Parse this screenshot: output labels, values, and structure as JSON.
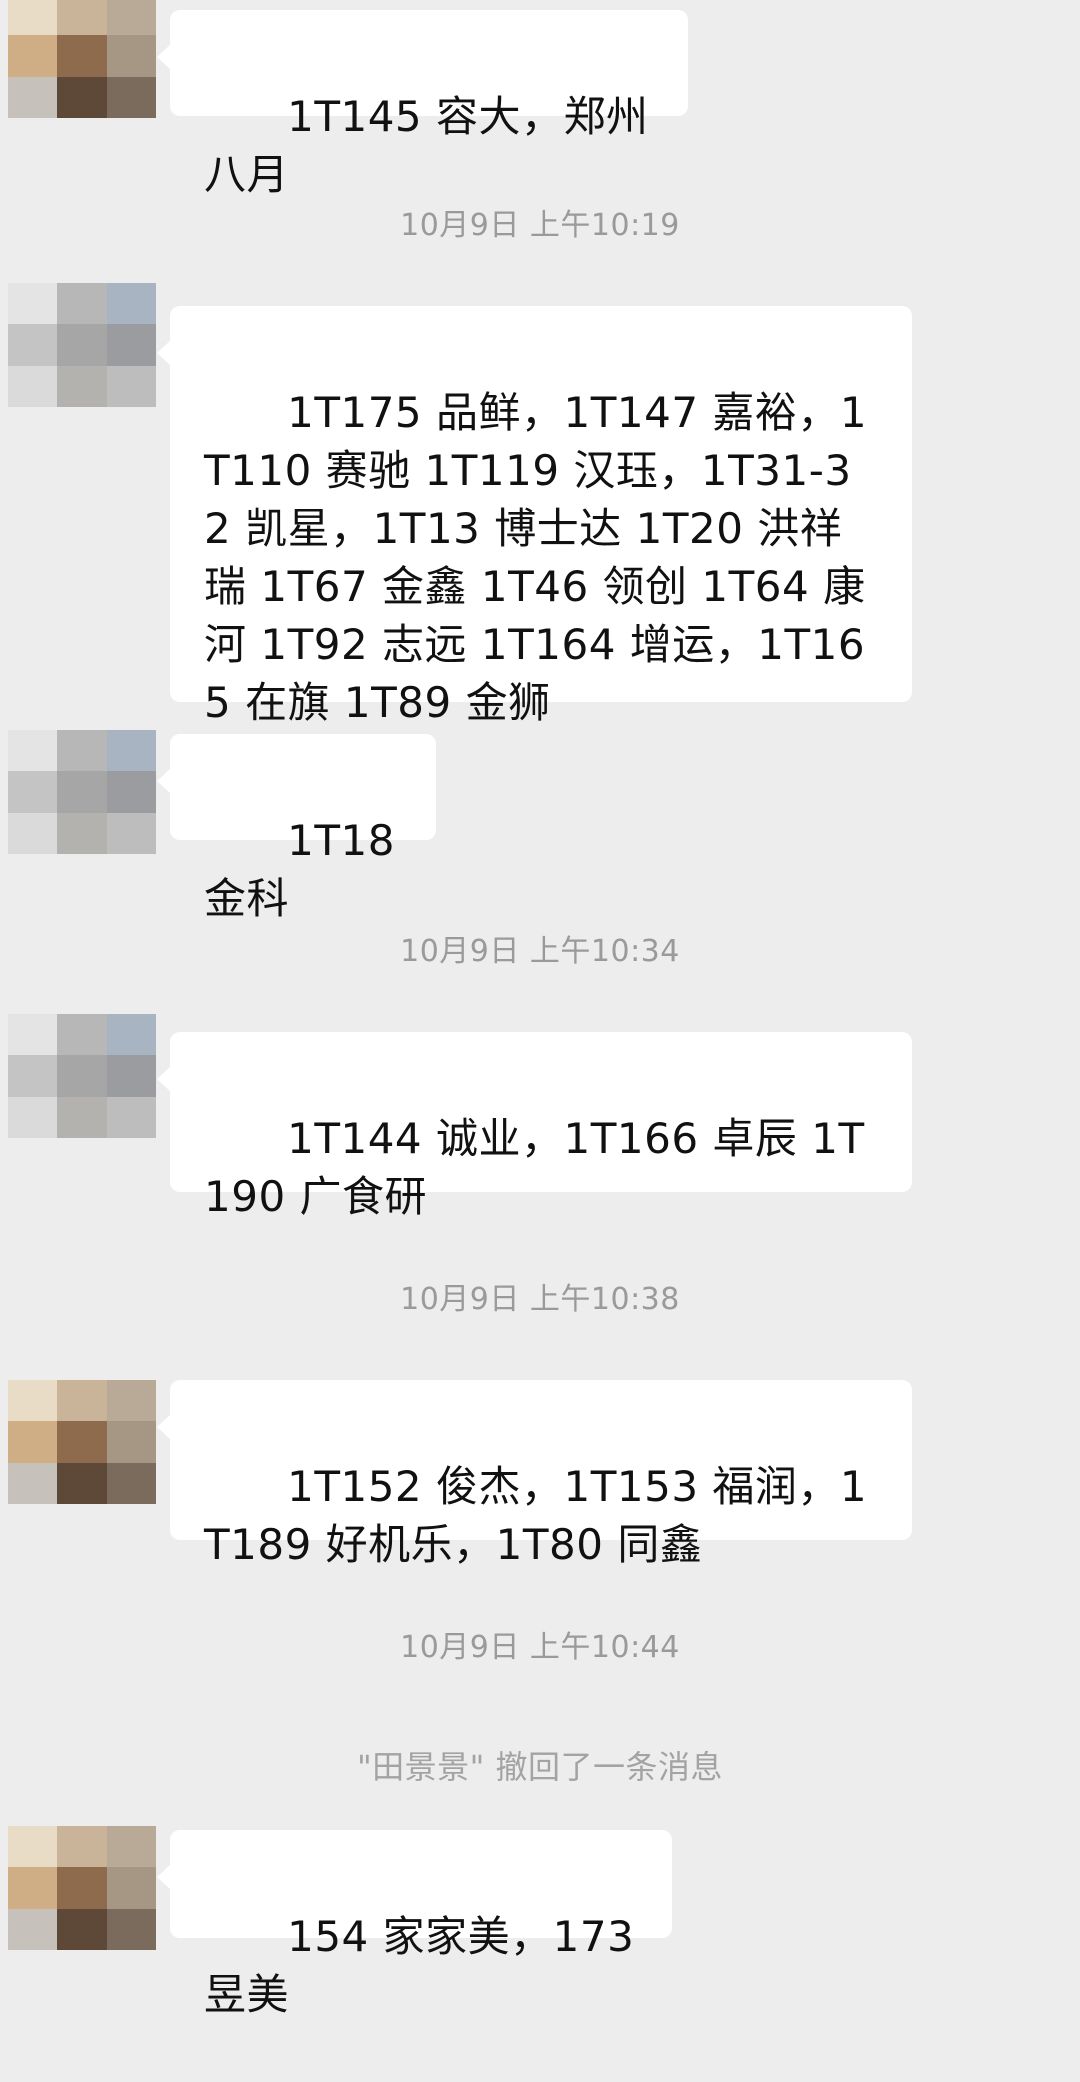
{
  "messages": [
    {
      "type": "message",
      "text": "1T145 容大，郑州八月",
      "avatar": "avatar-1"
    },
    {
      "type": "timestamp",
      "text": "10月9日 上午10:19"
    },
    {
      "type": "message",
      "text": "1T175 品鲜，1T147 嘉裕，1T110 赛驰 1T119 汉珏，1T31-32 凯星，1T13 博士达 1T20 洪祥瑞 1T67 金鑫 1T46 领创 1T64 康河 1T92 志远 1T164 增运，1T165 在旗 1T89 金狮",
      "avatar": "avatar-2"
    },
    {
      "type": "message",
      "text": "1T18 金科",
      "avatar": "avatar-2"
    },
    {
      "type": "timestamp",
      "text": "10月9日 上午10:34"
    },
    {
      "type": "message",
      "text": "1T144 诚业，1T166 卓辰 1T190 广食研",
      "avatar": "avatar-2"
    },
    {
      "type": "timestamp",
      "text": "10月9日 上午10:38"
    },
    {
      "type": "message",
      "text": "1T152 俊杰，1T153 福润，1T189 好机乐，1T80 同鑫",
      "avatar": "avatar-1"
    },
    {
      "type": "timestamp",
      "text": "10月9日 上午10:44"
    },
    {
      "type": "recall",
      "text": "\"田景景\" 撤回了一条消息"
    },
    {
      "type": "message",
      "text": "154 家家美，173 昱美",
      "avatar": "avatar-1"
    }
  ],
  "colors": {
    "background": "#ededed",
    "bubble": "#ffffff",
    "timestamp_text": "#9a9a9a",
    "recall_text": "#a3a3a3",
    "avatar_1": [
      "#e9dcc6",
      "#c9b49a",
      "#b9aa97",
      "#cfae86",
      "#8d6b4c",
      "#a59784",
      "#c7c1bb",
      "#5e4838",
      "#7b6b5d"
    ],
    "avatar_2": [
      "#e4e4e4",
      "#b7b7b7",
      "#a9b4c2",
      "#c4c4c4",
      "#a6a6a6",
      "#9a9ca0",
      "#dadada",
      "#b4b2ae",
      "#bdbdbd"
    ]
  }
}
